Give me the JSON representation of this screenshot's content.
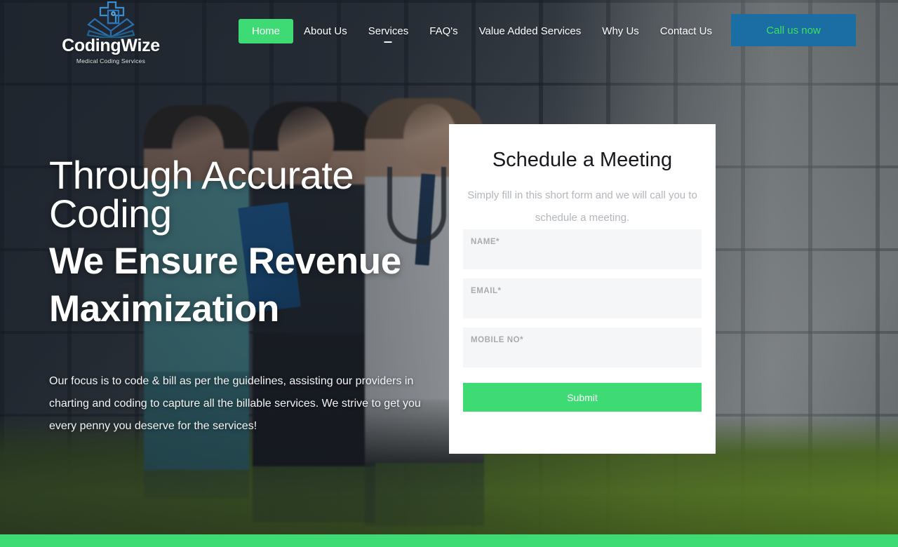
{
  "header": {
    "logo": {
      "icon": "medical-cross-book-logo",
      "word": "CodingWize",
      "tagline": "Medical Coding Services"
    },
    "nav": [
      {
        "label": "Home",
        "active": true,
        "caret": false
      },
      {
        "label": "About Us",
        "active": false,
        "caret": false
      },
      {
        "label": "Services",
        "active": false,
        "caret": true
      },
      {
        "label": "FAQ's",
        "active": false,
        "caret": false
      },
      {
        "label": "Value Added Services",
        "active": false,
        "caret": false
      },
      {
        "label": "Why Us",
        "active": false,
        "caret": false
      },
      {
        "label": "Contact Us",
        "active": false,
        "caret": false
      }
    ],
    "call_button": "Call us now"
  },
  "hero": {
    "headline_light_line1": "Through Accurate",
    "headline_light_line2": "Coding",
    "headline_bold_line1": "We Ensure Revenue",
    "headline_bold_line2": "Maximization",
    "paragraph": "Our focus is to code & bill as per the guidelines, assisting our providers in charting and coding to capture all the billable services. We strive to get you every penny you deserve for the services!"
  },
  "form": {
    "title": "Schedule a Meeting",
    "subtitle": "Simply fill in this short form and we will call you to schedule a meeting.",
    "fields": [
      {
        "name": "name",
        "label": "NAME*",
        "value": "",
        "placeholder": ""
      },
      {
        "name": "email",
        "label": "EMAIL*",
        "value": "",
        "placeholder": ""
      },
      {
        "name": "mobile",
        "label": "MOBILE NO*",
        "value": "",
        "placeholder": ""
      }
    ],
    "submit_label": "Submit"
  },
  "colors": {
    "accent_green": "#3edb74",
    "call_button_blue": "#1a6ea3",
    "call_button_text_green": "#3ce05f",
    "logo_blue": "#2f7fc4",
    "field_bg": "#f5f6f7",
    "card_bg": "#ffffff"
  }
}
